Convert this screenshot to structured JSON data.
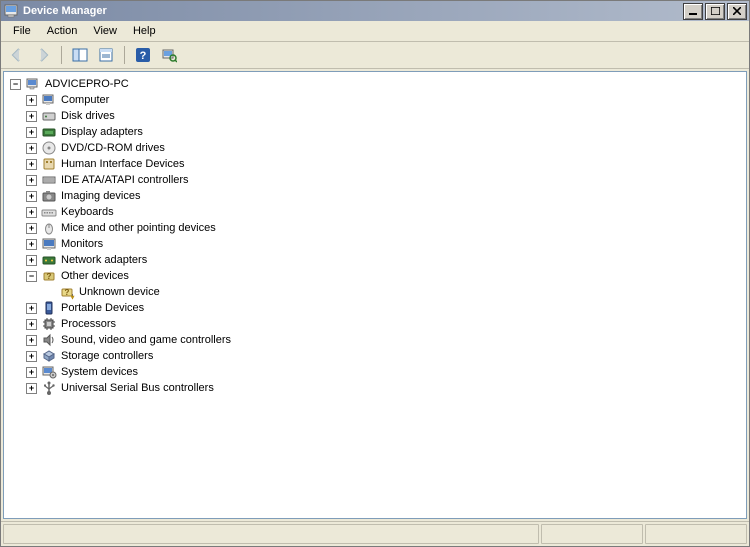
{
  "window": {
    "title": "Device Manager",
    "buttons": {
      "minimize": "_",
      "maximize": "□",
      "close": "✕"
    }
  },
  "menu": {
    "file": "File",
    "action": "Action",
    "view": "View",
    "help": "Help"
  },
  "toolbar": {
    "back": "Back",
    "forward": "Forward",
    "show_hide": "Show/Hide Console Tree",
    "properties": "Properties",
    "help": "Help",
    "scan": "Scan for hardware changes"
  },
  "tree": {
    "root": {
      "label": "ADVICEPRO-PC",
      "expanded": true
    },
    "items": [
      {
        "id": "computer",
        "label": "Computer",
        "expandable": true,
        "icon": "computer"
      },
      {
        "id": "disk-drives",
        "label": "Disk drives",
        "expandable": true,
        "icon": "disk"
      },
      {
        "id": "display-adapters",
        "label": "Display adapters",
        "expandable": true,
        "icon": "display"
      },
      {
        "id": "dvd-cd-rom",
        "label": "DVD/CD-ROM drives",
        "expandable": true,
        "icon": "dvd"
      },
      {
        "id": "hid",
        "label": "Human Interface Devices",
        "expandable": true,
        "icon": "hid"
      },
      {
        "id": "ide",
        "label": "IDE ATA/ATAPI controllers",
        "expandable": true,
        "icon": "ide"
      },
      {
        "id": "imaging",
        "label": "Imaging devices",
        "expandable": true,
        "icon": "camera"
      },
      {
        "id": "keyboards",
        "label": "Keyboards",
        "expandable": true,
        "icon": "keyboard"
      },
      {
        "id": "mice",
        "label": "Mice and other pointing devices",
        "expandable": true,
        "icon": "mouse"
      },
      {
        "id": "monitors",
        "label": "Monitors",
        "expandable": true,
        "icon": "monitor"
      },
      {
        "id": "network",
        "label": "Network adapters",
        "expandable": true,
        "icon": "network"
      },
      {
        "id": "other-devices",
        "label": "Other devices",
        "expandable": true,
        "expanded": true,
        "icon": "other",
        "children": [
          {
            "id": "unknown-device",
            "label": "Unknown device",
            "icon": "unknown"
          }
        ]
      },
      {
        "id": "portable",
        "label": "Portable Devices",
        "expandable": true,
        "icon": "portable"
      },
      {
        "id": "processors",
        "label": "Processors",
        "expandable": true,
        "icon": "processor"
      },
      {
        "id": "sound",
        "label": "Sound, video and game controllers",
        "expandable": true,
        "icon": "sound"
      },
      {
        "id": "storage",
        "label": "Storage controllers",
        "expandable": true,
        "icon": "storage"
      },
      {
        "id": "system",
        "label": "System devices",
        "expandable": true,
        "icon": "system"
      },
      {
        "id": "usb",
        "label": "Universal Serial Bus controllers",
        "expandable": true,
        "icon": "usb"
      }
    ]
  },
  "status": {
    "pane1": "",
    "pane2": "",
    "pane3": ""
  }
}
